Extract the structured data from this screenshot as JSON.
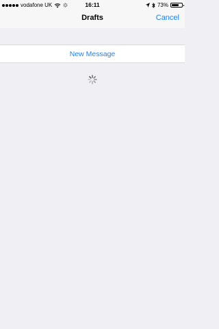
{
  "status_bar": {
    "carrier": "vodafone UK",
    "time": "16:11",
    "battery_percent": "73%",
    "battery_level": 0.73,
    "icons": [
      "signal-dots-icon",
      "wifi-icon",
      "activity-icon",
      "location-arrow-icon",
      "bluetooth-icon",
      "battery-icon"
    ]
  },
  "nav": {
    "title": "Drafts",
    "cancel_label": "Cancel"
  },
  "main": {
    "new_message_label": "New Message",
    "loading_icon": "activity-spinner-icon"
  },
  "colors": {
    "accent": "#1a82f7",
    "background": "#efeff4",
    "bar": "#f7f7f7"
  }
}
